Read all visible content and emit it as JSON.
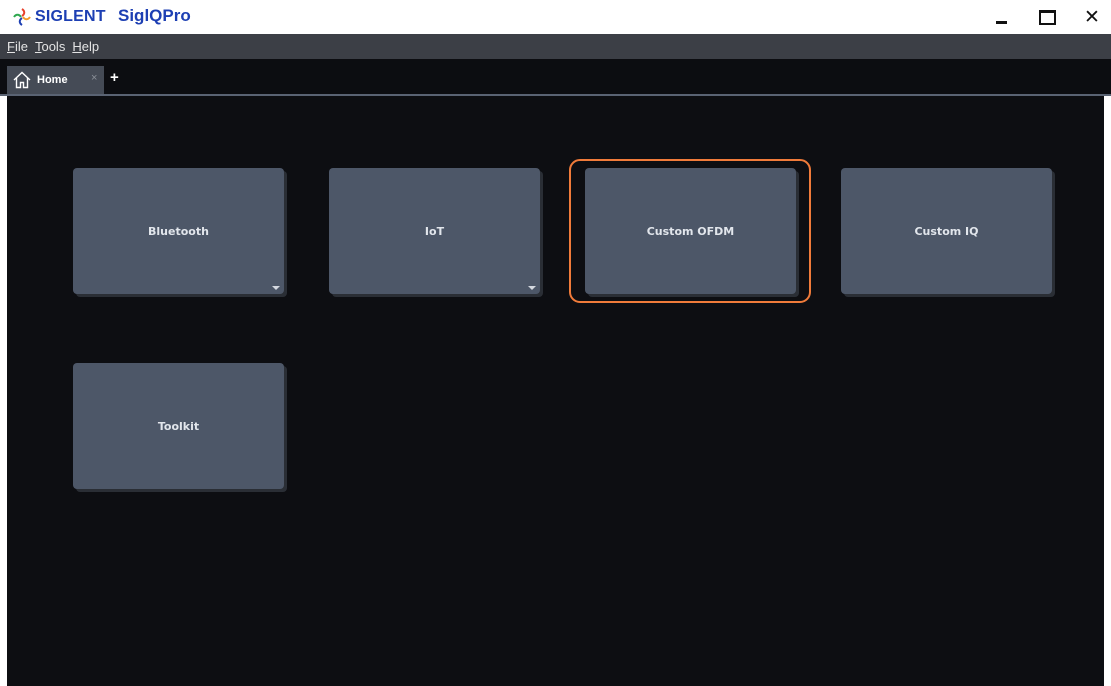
{
  "titlebar": {
    "brand": "SIGLENT",
    "app_title": "SiglQPro",
    "minimize_icon": "minimize-icon",
    "maximize_icon": "maximize-icon",
    "close_label": "✕"
  },
  "menu": {
    "items": [
      {
        "label": "File",
        "accel": "F"
      },
      {
        "label": "Tools",
        "accel": "T"
      },
      {
        "label": "Help",
        "accel": "H"
      }
    ]
  },
  "tabs": {
    "active": {
      "label": "Home",
      "icon": "home-icon",
      "close_label": "×"
    },
    "add_label": "+"
  },
  "cards": [
    {
      "label": "Bluetooth",
      "has_menu": true
    },
    {
      "label": "IoT",
      "has_menu": true
    },
    {
      "label": "Custom OFDM",
      "has_menu": false,
      "highlighted": true
    },
    {
      "label": "Custom IQ",
      "has_menu": false
    },
    {
      "label": "Toolkit",
      "has_menu": false
    }
  ],
  "colors": {
    "brand_blue": "#1d3fb3",
    "highlight_orange": "#f07b3a",
    "card_bg": "#4d5768",
    "main_bg": "#0d0e12"
  }
}
